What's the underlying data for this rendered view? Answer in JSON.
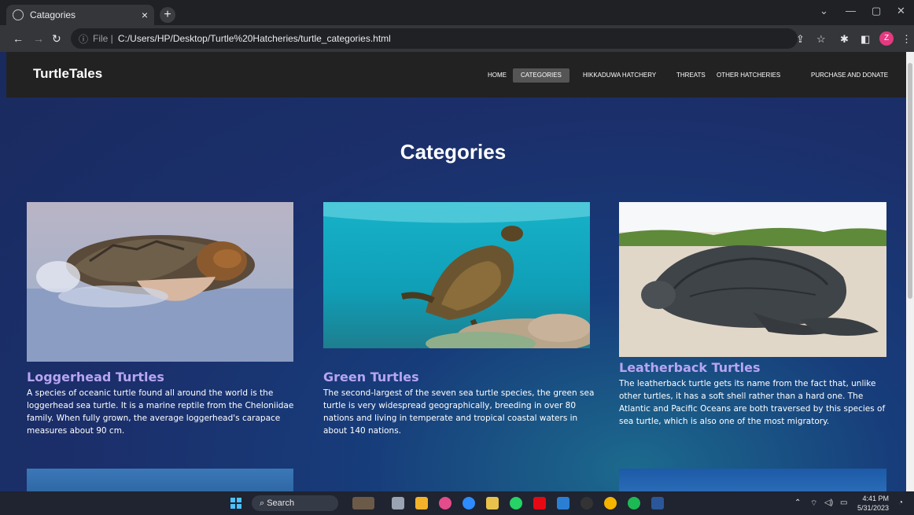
{
  "browser": {
    "tab_title": "Catagories",
    "tab_close": "×",
    "new_tab": "+",
    "file_label": "File |",
    "url": "C:/Users/HP/Desktop/Turtle%20Hatcheries/turtle_categories.html",
    "profile_initial": "Z"
  },
  "site": {
    "logo": "TurtleTales",
    "nav": [
      "HOME",
      "CATEGORIES",
      "HIKKADUWA HATCHERY",
      "THREATS",
      "OTHER HATCHERIES",
      "PURCHASE AND DONATE"
    ],
    "active_nav": "CATEGORIES",
    "heading": "Categories"
  },
  "cards": [
    {
      "title": "Loggerhead Turtles",
      "text": "A species of oceanic turtle found all around the world is the loggerhead sea turtle. It is a marine reptile from the Cheloniidae family. When fully grown, the average loggerhead's carapace measures about 90 cm."
    },
    {
      "title": "Green Turtles",
      "text": "The second-largest of the seven sea turtle species, the green sea turtle is very widespread geographically, breeding in over 80 nations and living in temperate and tropical coastal waters in about 140 nations."
    },
    {
      "title": "Leatherback Turtles",
      "text": "The leatherback turtle gets its name from the fact that, unlike other turtles, it has a soft shell rather than a hard one. The Atlantic and Pacific Oceans are both traversed by this species of sea turtle, which is also one of the most migratory."
    }
  ],
  "taskbar": {
    "search_label": "Search",
    "time": "4:41 PM",
    "date": "5/31/2023"
  },
  "colors": {
    "card_title": "#b7a5f2",
    "nav_bg": "#222222",
    "page_bg": "#192a5e"
  }
}
